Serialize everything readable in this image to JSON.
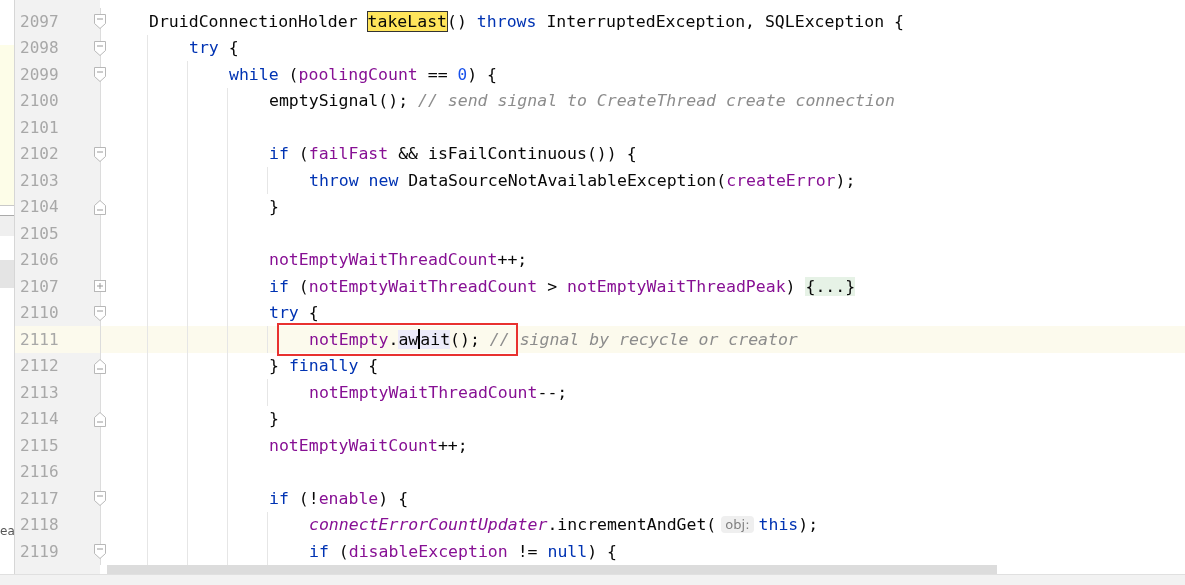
{
  "side_panel": {
    "label": "ea"
  },
  "lines": [
    {
      "number": "2097",
      "kind": "open",
      "current": false,
      "boxed": false,
      "tokens": [
        {
          "kind": "plain",
          "text": "DruidConnectionHolder "
        },
        {
          "kind": "match",
          "text": "takeLast"
        },
        {
          "kind": "plain",
          "text": "() "
        },
        {
          "kind": "kw",
          "text": "throws"
        },
        {
          "kind": "plain",
          "text": " InterruptedException, SQLException {"
        }
      ],
      "children": [
        {
          "number": "2098",
          "kind": "open",
          "current": false,
          "boxed": false,
          "tokens": [
            {
              "kind": "kw",
              "text": "try"
            },
            {
              "kind": "plain",
              "text": " {"
            }
          ],
          "children": [
            {
              "number": "2099",
              "kind": "open",
              "current": false,
              "boxed": false,
              "tokens": [
                {
                  "kind": "kw",
                  "text": "while"
                },
                {
                  "kind": "plain",
                  "text": " ("
                },
                {
                  "kind": "field",
                  "text": "poolingCount"
                },
                {
                  "kind": "plain",
                  "text": " == "
                },
                {
                  "kind": "num",
                  "text": "0"
                },
                {
                  "kind": "plain",
                  "text": ") {"
                }
              ],
              "children": [
                {
                  "number": "2100",
                  "kind": "plain",
                  "current": false,
                  "boxed": false,
                  "tokens": [
                    {
                      "kind": "plain",
                      "text": "emptySignal(); "
                    },
                    {
                      "kind": "comment",
                      "text": "// send signal to CreateThread create connection"
                    }
                  ]
                },
                {
                  "number": "2101",
                  "kind": "plain",
                  "current": false,
                  "boxed": false
                },
                {
                  "number": "2102",
                  "kind": "open",
                  "current": false,
                  "boxed": false,
                  "tokens": [
                    {
                      "kind": "kw",
                      "text": "if"
                    },
                    {
                      "kind": "plain",
                      "text": " ("
                    },
                    {
                      "kind": "field",
                      "text": "failFast"
                    },
                    {
                      "kind": "plain",
                      "text": " && isFailContinuous()) {"
                    }
                  ],
                  "children": [
                    {
                      "number": "2103",
                      "kind": "plain",
                      "current": false,
                      "boxed": false,
                      "tokens": [
                        {
                          "kind": "kw",
                          "text": "throw "
                        },
                        {
                          "kind": "kw",
                          "text": "new"
                        },
                        {
                          "kind": "plain",
                          "text": " DataSourceNotAvailableException("
                        },
                        {
                          "kind": "field",
                          "text": "createError"
                        },
                        {
                          "kind": "plain",
                          "text": ");"
                        }
                      ]
                    }
                  ]
                },
                {
                  "number": "2104",
                  "kind": "close",
                  "current": false,
                  "boxed": false,
                  "tokens": [
                    {
                      "kind": "plain",
                      "text": "}"
                    }
                  ]
                },
                {
                  "number": "2105",
                  "kind": "plain",
                  "current": false,
                  "boxed": false
                },
                {
                  "number": "2106",
                  "kind": "plain",
                  "current": false,
                  "boxed": false,
                  "tokens": [
                    {
                      "kind": "field",
                      "text": "notEmptyWaitThreadCount"
                    },
                    {
                      "kind": "plain",
                      "text": "++;"
                    }
                  ]
                },
                {
                  "number": "2107",
                  "kind": "collapsed",
                  "current": false,
                  "boxed": false,
                  "tokens": [
                    {
                      "kind": "kw",
                      "text": "if"
                    },
                    {
                      "kind": "plain",
                      "text": " ("
                    },
                    {
                      "kind": "field",
                      "text": "notEmptyWaitThreadCount"
                    },
                    {
                      "kind": "plain",
                      "text": " > "
                    },
                    {
                      "kind": "field",
                      "text": "notEmptyWaitThreadPeak"
                    },
                    {
                      "kind": "plain",
                      "text": ") "
                    },
                    {
                      "kind": "folded",
                      "text": "{...}"
                    }
                  ]
                },
                {
                  "number": "2110",
                  "kind": "open",
                  "current": false,
                  "boxed": false,
                  "tokens": [
                    {
                      "kind": "kw",
                      "text": "try"
                    },
                    {
                      "kind": "plain",
                      "text": " {"
                    }
                  ],
                  "children": [
                    {
                      "number": "2111",
                      "kind": "plain",
                      "current": true,
                      "boxed": true,
                      "tokens": [
                        {
                          "kind": "field",
                          "text": "notEmpty"
                        },
                        {
                          "kind": "plain",
                          "text": "."
                        },
                        {
                          "kind": "usage",
                          "text": "aw"
                        },
                        {
                          "kind": "caret"
                        },
                        {
                          "kind": "usage",
                          "text": "ait"
                        },
                        {
                          "kind": "plain",
                          "text": "(); "
                        },
                        {
                          "kind": "comment",
                          "text": "// signal by recycle or creator"
                        }
                      ]
                    }
                  ]
                },
                {
                  "number": "2112",
                  "kind": "close",
                  "current": false,
                  "boxed": false,
                  "tokens": [
                    {
                      "kind": "plain",
                      "text": "} "
                    },
                    {
                      "kind": "kw",
                      "text": "finally"
                    },
                    {
                      "kind": "plain",
                      "text": " {"
                    }
                  ],
                  "children": [
                    {
                      "number": "2113",
                      "kind": "plain",
                      "current": false,
                      "boxed": false,
                      "tokens": [
                        {
                          "kind": "field",
                          "text": "notEmptyWaitThreadCount"
                        },
                        {
                          "kind": "plain",
                          "text": "--;"
                        }
                      ]
                    }
                  ]
                },
                {
                  "number": "2114",
                  "kind": "close",
                  "current": false,
                  "boxed": false,
                  "tokens": [
                    {
                      "kind": "plain",
                      "text": "}"
                    }
                  ]
                },
                {
                  "number": "2115",
                  "kind": "plain",
                  "current": false,
                  "boxed": false,
                  "tokens": [
                    {
                      "kind": "field",
                      "text": "notEmptyWaitCount"
                    },
                    {
                      "kind": "plain",
                      "text": "++;"
                    }
                  ]
                },
                {
                  "number": "2116",
                  "kind": "plain",
                  "current": false,
                  "boxed": false
                },
                {
                  "number": "2117",
                  "kind": "open",
                  "current": false,
                  "boxed": false,
                  "tokens": [
                    {
                      "kind": "kw",
                      "text": "if"
                    },
                    {
                      "kind": "plain",
                      "text": " (!"
                    },
                    {
                      "kind": "field",
                      "text": "enable"
                    },
                    {
                      "kind": "plain",
                      "text": ") {"
                    }
                  ],
                  "children": [
                    {
                      "number": "2118",
                      "kind": "plain",
                      "current": false,
                      "boxed": false,
                      "tokens": [
                        {
                          "kind": "static",
                          "text": "connectErrorCountUpdater"
                        },
                        {
                          "kind": "plain",
                          "text": ".incrementAndGet("
                        },
                        {
                          "kind": "hint",
                          "text": "obj:"
                        },
                        {
                          "kind": "kw",
                          "text": "this"
                        },
                        {
                          "kind": "plain",
                          "text": ");"
                        }
                      ]
                    },
                    {
                      "number": "2119",
                      "kind": "open",
                      "current": false,
                      "boxed": false,
                      "tokens": [
                        {
                          "kind": "kw",
                          "text": "if"
                        },
                        {
                          "kind": "plain",
                          "text": " ("
                        },
                        {
                          "kind": "field",
                          "text": "disableException"
                        },
                        {
                          "kind": "plain",
                          "text": " != "
                        },
                        {
                          "kind": "kw",
                          "text": "null"
                        },
                        {
                          "kind": "plain",
                          "text": ") {"
                        }
                      ]
                    }
                  ]
                }
              ]
            }
          ]
        }
      ]
    }
  ]
}
